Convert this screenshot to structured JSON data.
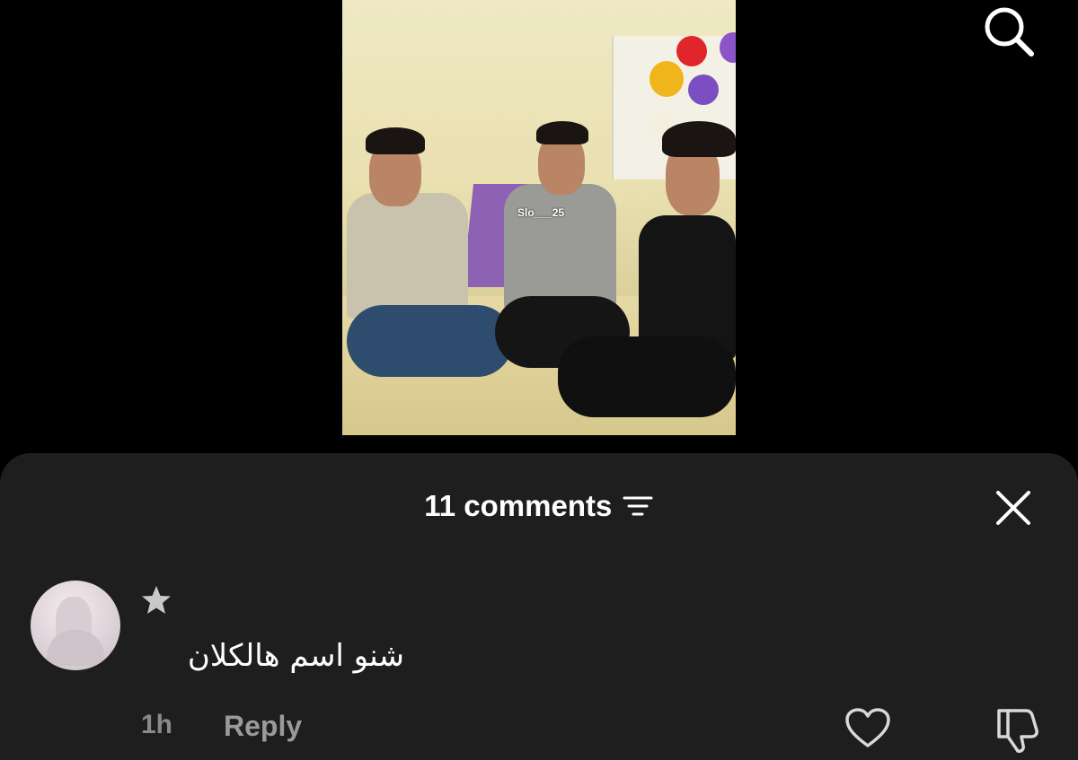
{
  "video": {
    "watermark": "Slo___25"
  },
  "icons": {
    "search": "search-icon",
    "sort": "sort-icon",
    "close": "close-icon",
    "star": "star-icon",
    "like": "heart-icon",
    "dislike": "thumbs-down-icon"
  },
  "comments_panel": {
    "title": "11 comments",
    "items": [
      {
        "text": "شنو اسم هالكلان",
        "time": "1h",
        "reply_label": "Reply"
      }
    ]
  },
  "colors": {
    "background": "#000000",
    "sheet": "#1e1e1e",
    "secondary_text": "#8a8a8a"
  }
}
